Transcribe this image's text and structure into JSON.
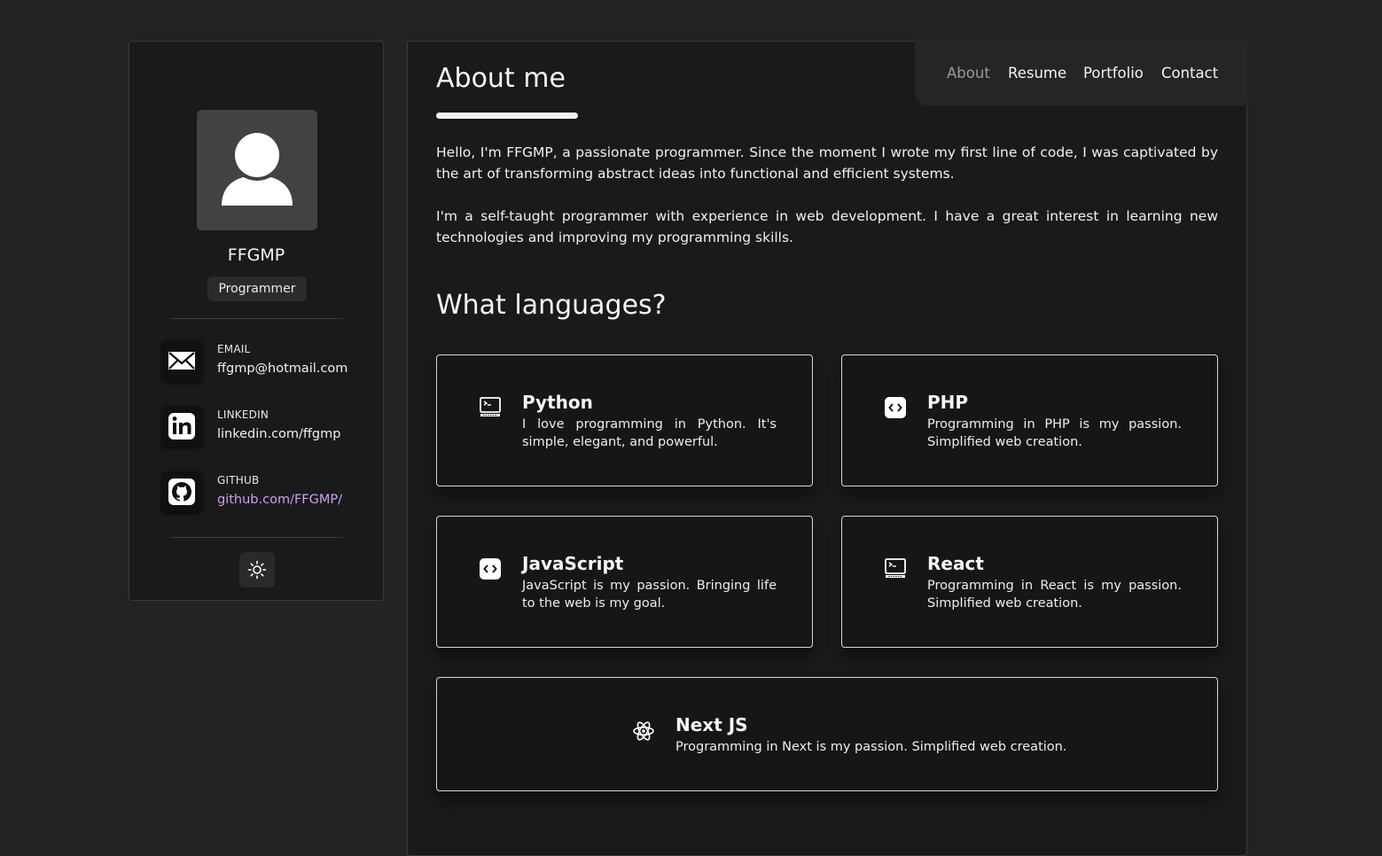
{
  "profile": {
    "name": "FFGMP",
    "role": "Programmer"
  },
  "contacts": [
    {
      "title": "EMAIL",
      "value": "ffgmp@hotmail.com",
      "icon": "mail-icon"
    },
    {
      "title": "LINKEDIN",
      "value": "linkedin.com/ffgmp",
      "icon": "linkedin-icon"
    },
    {
      "title": "GITHUB",
      "value": "github.com/FFGMP/",
      "icon": "github-icon"
    }
  ],
  "theme_toggle": {
    "icon": "sun-icon"
  },
  "nav": {
    "items": [
      "About",
      "Resume",
      "Portfolio",
      "Contact"
    ],
    "active": "About"
  },
  "about": {
    "title": "About me",
    "paragraphs": [
      "Hello, I'm FFGMP, a passionate programmer. Since the moment I wrote my first line of code, I was captivated by the art of transforming abstract ideas into functional and efficient systems.",
      "I'm a self-taught programmer with experience in web development. I have a great interest in learning new technologies and improving my programming skills."
    ]
  },
  "languages": {
    "title": "What languages?",
    "items": [
      {
        "name": "Python",
        "description": "I love programming in Python. It's simple, elegant, and powerful.",
        "icon": "terminal-icon"
      },
      {
        "name": "PHP",
        "description": "Programming in PHP is my passion. Simplified web creation.",
        "icon": "code-icon"
      },
      {
        "name": "JavaScript",
        "description": "JavaScript is my passion. Bringing life to the web is my goal.",
        "icon": "code-icon"
      },
      {
        "name": "React",
        "description": "Programming in React is my passion. Simplified web creation.",
        "icon": "terminal-icon"
      },
      {
        "name": "Next JS",
        "description": "Programming in Next is my passion. Simplified web creation.",
        "icon": "atom-icon"
      }
    ]
  },
  "colors": {
    "background": "#232323",
    "panel": "#1a1a1a",
    "link": "#c7a2f2",
    "nav_active": "#9a9a9a"
  }
}
